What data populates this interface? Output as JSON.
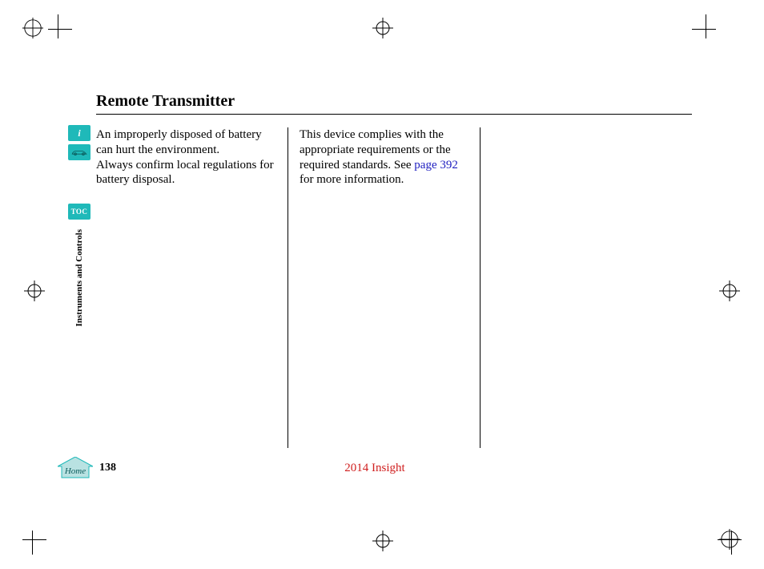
{
  "title": "Remote Transmitter",
  "column1": {
    "p1": "An improperly disposed of battery can hurt the environment.",
    "p2": "Always confirm local regulations for battery disposal."
  },
  "column2": {
    "before_link": "This device complies with the appropriate requirements or the required standards. See ",
    "link_text": "page 392",
    "after_link": " for more information."
  },
  "sidebar": {
    "info_glyph": "i",
    "toc_label": "TOC",
    "section_label": "Instruments and Controls"
  },
  "footer": {
    "home_label": "Home",
    "page_number": "138",
    "model_year": "2014 Insight"
  }
}
